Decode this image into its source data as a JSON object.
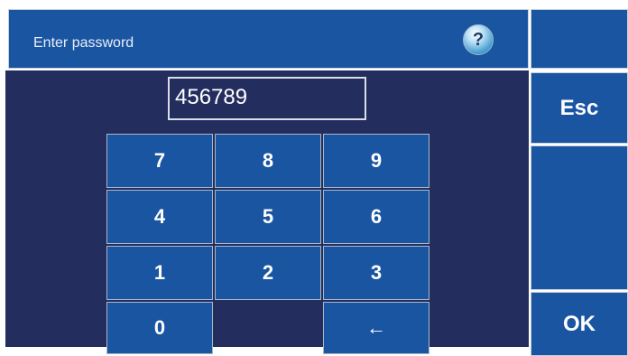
{
  "header": {
    "title": "Enter password",
    "help_icon": "question-mark-icon",
    "help_label": "?"
  },
  "password": {
    "value": "456789"
  },
  "keypad": {
    "k7": "7",
    "k8": "8",
    "k9": "9",
    "k4": "4",
    "k5": "5",
    "k6": "6",
    "k1": "1",
    "k2": "2",
    "k3": "3",
    "k0": "0",
    "backspace": "←"
  },
  "side": {
    "esc_label": "Esc",
    "ok_label": "OK"
  },
  "colors": {
    "panel_blue": "#1a55a2",
    "background_navy": "#232e5e",
    "border": "#c7d1de"
  }
}
